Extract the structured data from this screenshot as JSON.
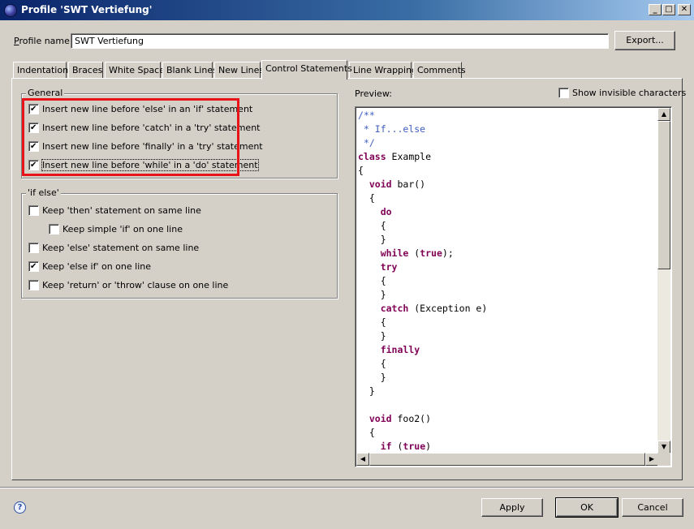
{
  "window": {
    "title": "Profile 'SWT Vertiefung'",
    "controls": {
      "minimize": "_",
      "maximize": "□",
      "close": "✕"
    }
  },
  "profile": {
    "label_mnemonic": "P",
    "label_rest": "rofile name:",
    "value": "SWT Vertiefung",
    "export_label": "Export..."
  },
  "tabs": [
    {
      "label": "Indentation",
      "active": false
    },
    {
      "label": "Braces",
      "active": false
    },
    {
      "label": "White Space",
      "active": false
    },
    {
      "label": "Blank Lines",
      "active": false
    },
    {
      "label": "New Lines",
      "active": false
    },
    {
      "label": "Control Statements",
      "active": true
    },
    {
      "label": "Line Wrapping",
      "active": false
    },
    {
      "label": "Comments",
      "active": false
    }
  ],
  "general": {
    "title": "General",
    "items": [
      {
        "label": "Insert new line before 'else' in an 'if' statement",
        "checked": true
      },
      {
        "label": "Insert new line before 'catch' in a 'try' statement",
        "checked": true
      },
      {
        "label": "Insert new line before 'finally' in a 'try' statement",
        "checked": true
      },
      {
        "label": "Insert new line before 'while' in a 'do' statement",
        "checked": true
      }
    ]
  },
  "ifelse": {
    "title": "'if else'",
    "items": [
      {
        "label": "Keep 'then' statement on same line",
        "checked": false
      },
      {
        "label": "Keep simple 'if' on one line",
        "checked": false
      },
      {
        "label": "Keep 'else' statement on same line",
        "checked": false
      },
      {
        "label": "Keep 'else if' on one line",
        "checked": true
      },
      {
        "label": "Keep 'return' or 'throw' clause on one line",
        "checked": false
      }
    ]
  },
  "preview": {
    "label": "Preview:",
    "show_invisible_label": "Show invisible characters",
    "show_invisible_checked": false,
    "code_lines": [
      [
        {
          "t": "/**",
          "c": "cm"
        }
      ],
      [
        {
          "t": " * If...else",
          "c": "cm"
        }
      ],
      [
        {
          "t": " */",
          "c": "cm"
        }
      ],
      [
        {
          "t": "class",
          "c": "kw"
        },
        {
          "t": " Example",
          "c": ""
        }
      ],
      [
        {
          "t": "{",
          "c": ""
        }
      ],
      [
        {
          "t": "  ",
          "c": ""
        },
        {
          "t": "void",
          "c": "kw"
        },
        {
          "t": " bar()",
          "c": ""
        }
      ],
      [
        {
          "t": "  {",
          "c": ""
        }
      ],
      [
        {
          "t": "    ",
          "c": ""
        },
        {
          "t": "do",
          "c": "kw"
        }
      ],
      [
        {
          "t": "    {",
          "c": ""
        }
      ],
      [
        {
          "t": "    }",
          "c": ""
        }
      ],
      [
        {
          "t": "    ",
          "c": ""
        },
        {
          "t": "while",
          "c": "kw"
        },
        {
          "t": " (",
          "c": ""
        },
        {
          "t": "true",
          "c": "kw"
        },
        {
          "t": ");",
          "c": ""
        }
      ],
      [
        {
          "t": "    ",
          "c": ""
        },
        {
          "t": "try",
          "c": "kw"
        }
      ],
      [
        {
          "t": "    {",
          "c": ""
        }
      ],
      [
        {
          "t": "    }",
          "c": ""
        }
      ],
      [
        {
          "t": "    ",
          "c": ""
        },
        {
          "t": "catch",
          "c": "kw"
        },
        {
          "t": " (Exception e)",
          "c": ""
        }
      ],
      [
        {
          "t": "    {",
          "c": ""
        }
      ],
      [
        {
          "t": "    }",
          "c": ""
        }
      ],
      [
        {
          "t": "    ",
          "c": ""
        },
        {
          "t": "finally",
          "c": "kw"
        }
      ],
      [
        {
          "t": "    {",
          "c": ""
        }
      ],
      [
        {
          "t": "    }",
          "c": ""
        }
      ],
      [
        {
          "t": "  }",
          "c": ""
        }
      ],
      [
        {
          "t": "",
          "c": ""
        }
      ],
      [
        {
          "t": "  ",
          "c": ""
        },
        {
          "t": "void",
          "c": "kw"
        },
        {
          "t": " foo2()",
          "c": ""
        }
      ],
      [
        {
          "t": "  {",
          "c": ""
        }
      ],
      [
        {
          "t": "    ",
          "c": ""
        },
        {
          "t": "if",
          "c": "kw"
        },
        {
          "t": " (",
          "c": ""
        },
        {
          "t": "true",
          "c": "kw"
        },
        {
          "t": ")",
          "c": ""
        }
      ]
    ]
  },
  "buttons": {
    "apply": "Apply",
    "ok": "OK",
    "cancel": "Cancel",
    "help": "?"
  },
  "colors": {
    "keyword": "#7f0055",
    "comment": "#3f5fbf",
    "highlight": "#e8141a",
    "titlebar": "#0a246a"
  }
}
